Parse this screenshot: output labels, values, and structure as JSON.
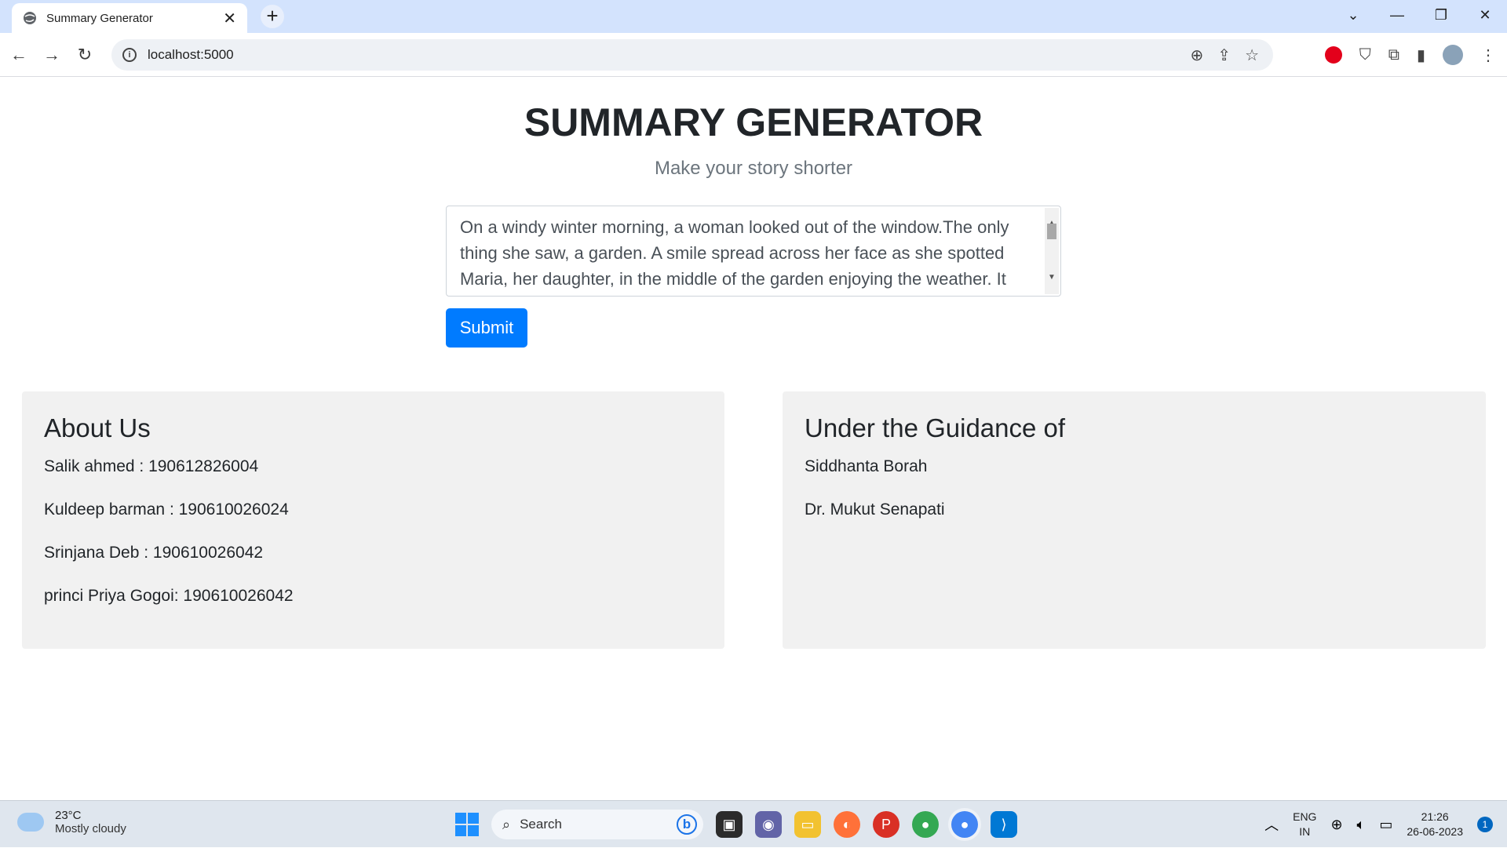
{
  "browser": {
    "tab_title": "Summary Generator",
    "new_tab": "+",
    "url": "localhost:5000"
  },
  "page": {
    "title": "SUMMARY GENERATOR",
    "subtitle": "Make your story shorter",
    "textarea_value": "On a windy winter morning, a woman looked out of the window.The only thing she saw, a garden. A smile spread across her face as she spotted Maria, her daughter, in the middle of the garden enjoying the weather. It",
    "submit_label": "Submit"
  },
  "about": {
    "heading": "About Us",
    "members": [
      "Salik ahmed : 190612826004",
      "Kuldeep barman : 190610026024",
      "Srinjana Deb : 190610026042",
      "princi Priya Gogoi: 190610026042"
    ]
  },
  "guidance": {
    "heading": "Under the Guidance of",
    "names": [
      "Siddhanta Borah",
      "Dr. Mukut Senapati"
    ]
  },
  "taskbar": {
    "temperature": "23°C",
    "weather": "Mostly cloudy",
    "search_placeholder": "Search",
    "lang_top": "ENG",
    "lang_bottom": "IN",
    "time": "21:26",
    "date": "26-06-2023",
    "notifications": "1"
  }
}
